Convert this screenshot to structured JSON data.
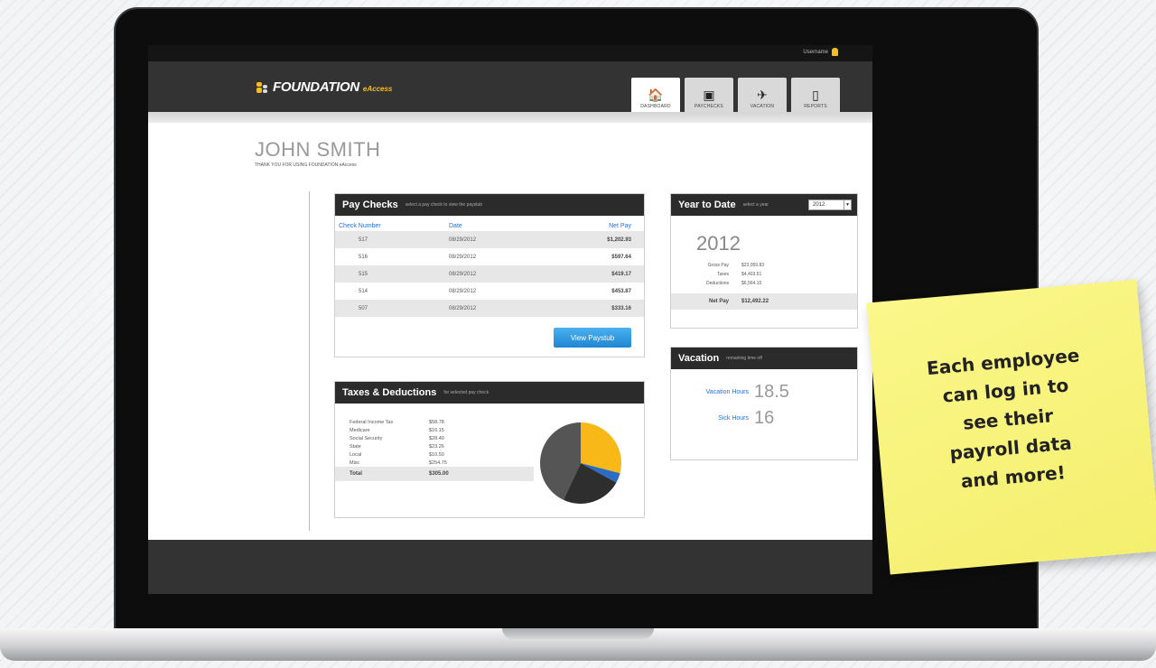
{
  "top_bar": {
    "user": "Username"
  },
  "brand": {
    "name": "FOUNDATION",
    "sub": "eAccess"
  },
  "tabs": [
    {
      "label": "DASHBOARD",
      "glyph": "🏠"
    },
    {
      "label": "PAYCHECKS",
      "glyph": "▣"
    },
    {
      "label": "VACATION",
      "glyph": "✈"
    },
    {
      "label": "REPORTS",
      "glyph": "▯"
    }
  ],
  "employee": {
    "name": "JOHN SMITH",
    "thanks": "THANK YOU FOR USING FOUNDATION eAccess"
  },
  "paychecks": {
    "title": "Pay Checks",
    "subtitle": "select a pay check to view the paystub",
    "columns": [
      "Check Number",
      "Date",
      "Net Pay"
    ],
    "rows": [
      {
        "num": "517",
        "date": "08/29/2012",
        "net": "$1,202.93"
      },
      {
        "num": "516",
        "date": "08/29/2012",
        "net": "$597.64"
      },
      {
        "num": "515",
        "date": "08/29/2012",
        "net": "$419.17"
      },
      {
        "num": "514",
        "date": "08/29/2012",
        "net": "$453.87"
      },
      {
        "num": "507",
        "date": "08/29/2012",
        "net": "$333.16"
      }
    ],
    "button": "View Paystub"
  },
  "ytd": {
    "title": "Year to Date",
    "subtitle": "select a year",
    "selected_year": "2012",
    "year": "2012",
    "lines": [
      {
        "label": "Gross Pay",
        "value": "$23,059.83"
      },
      {
        "label": "Taxes",
        "value": "$4,403.51"
      },
      {
        "label": "Deductions",
        "value": "$6,564.10"
      }
    ],
    "net_label": "Net Pay",
    "net_value": "$12,492.22"
  },
  "vacation": {
    "title": "Vacation",
    "subtitle": "remaining time off",
    "vac_label": "Vacation Hours",
    "vac_value": "18.5",
    "sick_label": "Sick Hours",
    "sick_value": "16"
  },
  "taxes": {
    "title": "Taxes & Deductions",
    "subtitle": "for selected pay check",
    "lines": [
      {
        "label": "Federal Income Tax",
        "value": "$58.78"
      },
      {
        "label": "Medicare",
        "value": "$16.15"
      },
      {
        "label": "Social Security",
        "value": "$28.40"
      },
      {
        "label": "State",
        "value": "$23.26"
      },
      {
        "label": "Local",
        "value": "$10.50"
      },
      {
        "label": "Misc",
        "value": "$254.75"
      }
    ],
    "total_label": "Total",
    "total_value": "$305.00"
  },
  "chart_data": {
    "type": "pie",
    "slices": [
      {
        "value": 29,
        "color": "#f7b818"
      },
      {
        "value": 4,
        "color": "#2b6cc4"
      },
      {
        "value": 24,
        "color": "#2e2e2e"
      },
      {
        "value": 43,
        "color": "#555555"
      }
    ]
  },
  "sticky_note": {
    "lines": [
      "Each employee",
      "can log in to",
      "see their",
      "payroll data",
      "and more!"
    ]
  },
  "colors": {
    "accent": "#f5bd1f",
    "link": "#2a6fc9",
    "header": "#333333",
    "note": "#fbf78a"
  }
}
